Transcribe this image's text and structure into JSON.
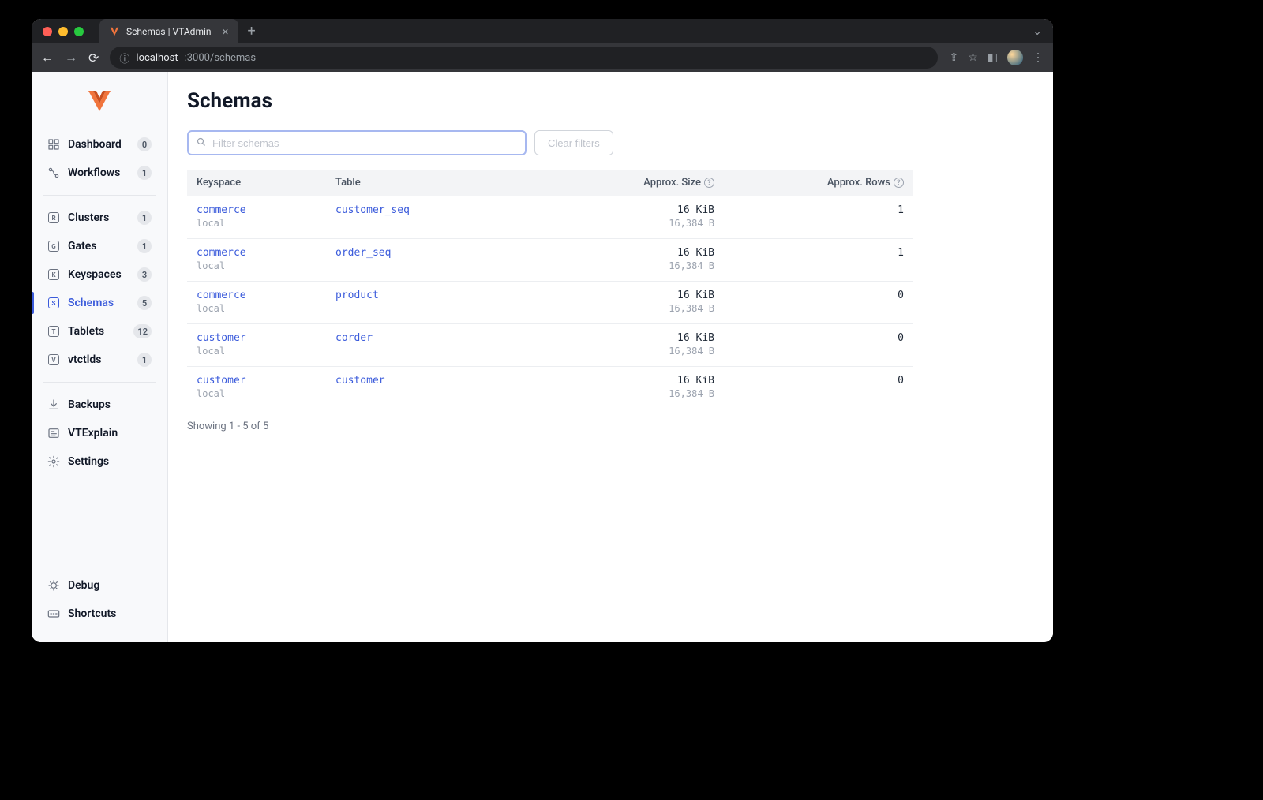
{
  "browser": {
    "tab_title": "Schemas | VTAdmin",
    "url_host": "localhost",
    "url_path": ":3000/schemas"
  },
  "sidebar": {
    "groups": [
      [
        {
          "id": "dashboard",
          "label": "Dashboard",
          "badge": "0",
          "icon": "dashboard"
        },
        {
          "id": "workflows",
          "label": "Workflows",
          "badge": "1",
          "icon": "workflows"
        }
      ],
      [
        {
          "id": "clusters",
          "label": "Clusters",
          "badge": "1",
          "icon": "R"
        },
        {
          "id": "gates",
          "label": "Gates",
          "badge": "1",
          "icon": "G"
        },
        {
          "id": "keyspaces",
          "label": "Keyspaces",
          "badge": "3",
          "icon": "K"
        },
        {
          "id": "schemas",
          "label": "Schemas",
          "badge": "5",
          "icon": "S",
          "active": true
        },
        {
          "id": "tablets",
          "label": "Tablets",
          "badge": "12",
          "icon": "T"
        },
        {
          "id": "vtctlds",
          "label": "vtctlds",
          "badge": "1",
          "icon": "V"
        }
      ],
      [
        {
          "id": "backups",
          "label": "Backups",
          "icon": "backups"
        },
        {
          "id": "vtexplain",
          "label": "VTExplain",
          "icon": "vtexplain"
        },
        {
          "id": "settings",
          "label": "Settings",
          "icon": "settings"
        }
      ]
    ],
    "bottom": [
      {
        "id": "debug",
        "label": "Debug",
        "icon": "debug"
      },
      {
        "id": "shortcuts",
        "label": "Shortcuts",
        "icon": "shortcuts"
      }
    ]
  },
  "page": {
    "title": "Schemas",
    "search_placeholder": "Filter schemas",
    "clear_filters": "Clear filters",
    "columns": {
      "keyspace": "Keyspace",
      "table": "Table",
      "approx_size": "Approx. Size",
      "approx_rows": "Approx. Rows"
    },
    "rows": [
      {
        "keyspace": "commerce",
        "cluster": "local",
        "table": "customer_seq",
        "size": "16 KiB",
        "size_bytes": "16,384 B",
        "rows": "1"
      },
      {
        "keyspace": "commerce",
        "cluster": "local",
        "table": "order_seq",
        "size": "16 KiB",
        "size_bytes": "16,384 B",
        "rows": "1"
      },
      {
        "keyspace": "commerce",
        "cluster": "local",
        "table": "product",
        "size": "16 KiB",
        "size_bytes": "16,384 B",
        "rows": "0"
      },
      {
        "keyspace": "customer",
        "cluster": "local",
        "table": "corder",
        "size": "16 KiB",
        "size_bytes": "16,384 B",
        "rows": "0"
      },
      {
        "keyspace": "customer",
        "cluster": "local",
        "table": "customer",
        "size": "16 KiB",
        "size_bytes": "16,384 B",
        "rows": "0"
      }
    ],
    "footer": "Showing 1 - 5 of 5"
  }
}
